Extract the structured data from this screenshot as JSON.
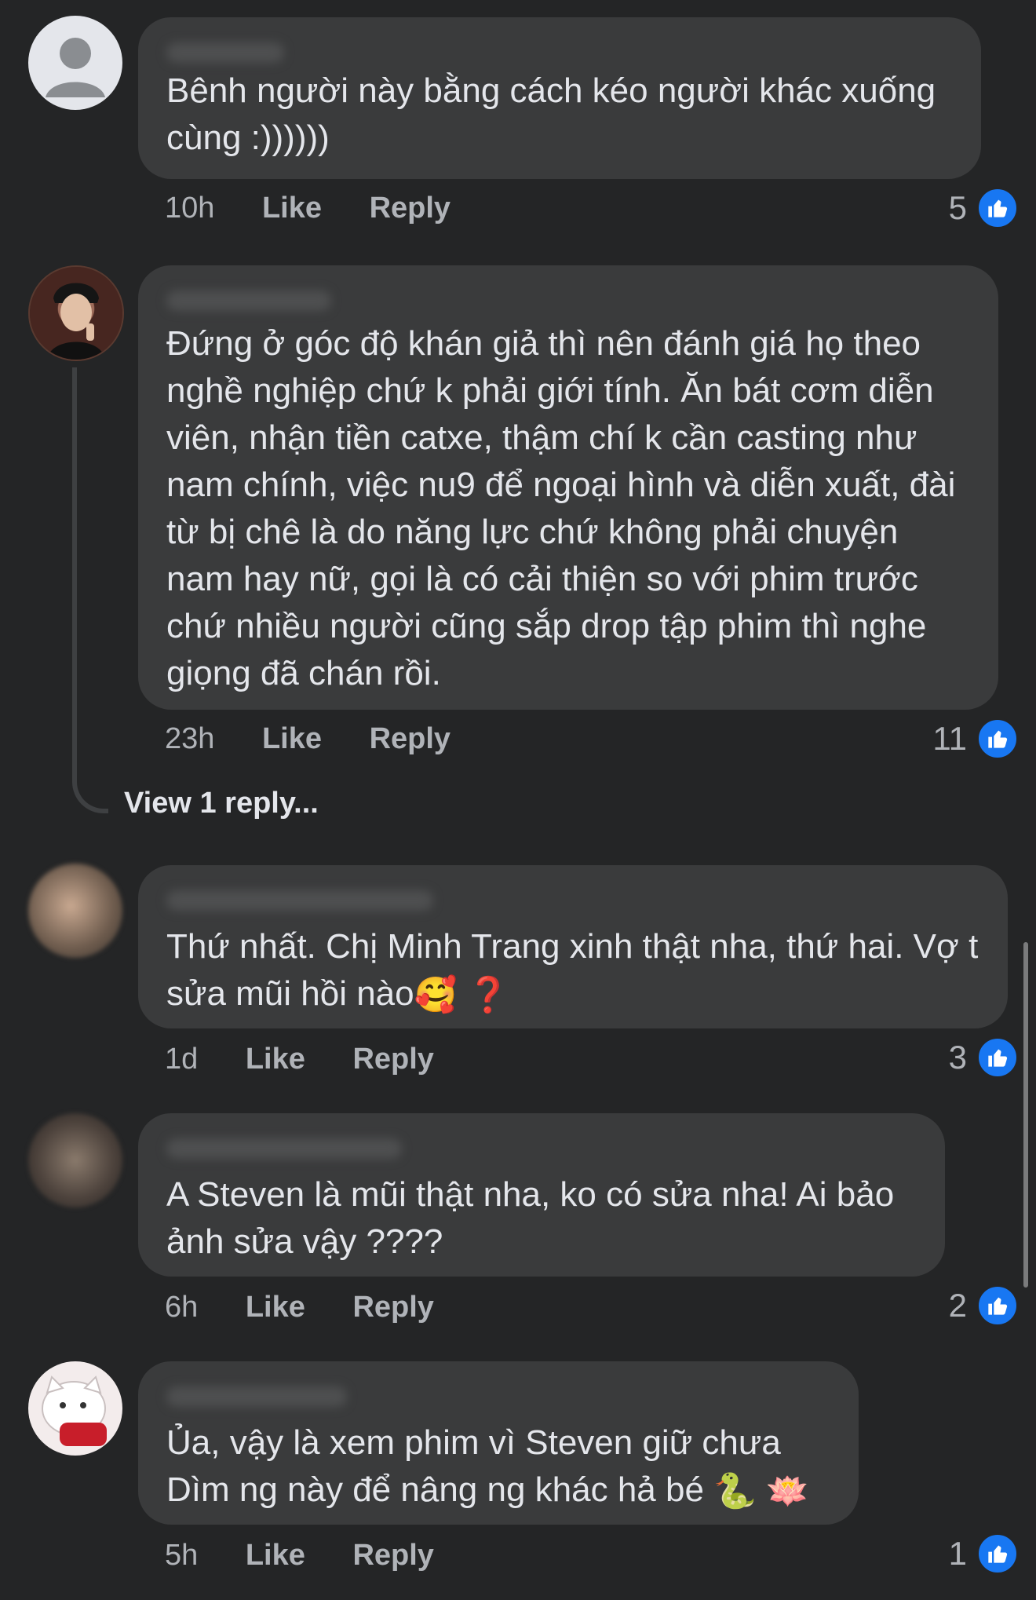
{
  "comments": [
    {
      "text": "Bênh người này bằng cách kéo người khác xuống cùng :))))))",
      "time": "10h",
      "like_label": "Like",
      "reply_label": "Reply",
      "likes": "5",
      "avatar": "default-avatar-icon"
    },
    {
      "text": "Đứng ở góc độ khán giả thì nên đánh giá họ theo nghề nghiệp chứ k phải giới tính. Ăn bát cơm diễn viên, nhận tiền catxe, thậm chí k cần casting như nam chính, việc nu9 để ngoại hình và diễn xuất, đài từ bị chê là do năng lực chứ không phải chuyện nam hay nữ, gọi là có cải thiện so với phim trước chứ nhiều người cũng sắp drop tập phim thì nghe giọng đã chán rồi.",
      "time": "23h",
      "like_label": "Like",
      "reply_label": "Reply",
      "likes": "11",
      "avatar": "user-photo-avatar",
      "view_replies": "View 1 reply..."
    },
    {
      "text": "Thứ nhất. Chị Minh Trang xinh thật nha, thứ hai. Vợ t sửa mũi hồi nào",
      "emojis": "🥰 ❓",
      "time": "1d",
      "like_label": "Like",
      "reply_label": "Reply",
      "likes": "3",
      "avatar": "blurred-avatar"
    },
    {
      "text": "A Steven là mũi thật nha, ko có sửa nha! Ai bảo ảnh sửa vậy ????",
      "time": "6h",
      "like_label": "Like",
      "reply_label": "Reply",
      "likes": "2",
      "avatar": "blurred-avatar"
    },
    {
      "text": "Ủa, vậy là xem phim vì Steven giữ chưa\nDìm ng này để nâng ng khác hả bé",
      "emojis": "🐍 🪷",
      "time": "5h",
      "like_label": "Like",
      "reply_label": "Reply",
      "likes": "1",
      "avatar": "cartoon-cat-avatar"
    }
  ],
  "colors": {
    "background": "#242526",
    "bubble": "#3a3b3c",
    "text": "#e4e6eb",
    "meta": "#b0b3b8",
    "like_blue": "#1877f2"
  }
}
